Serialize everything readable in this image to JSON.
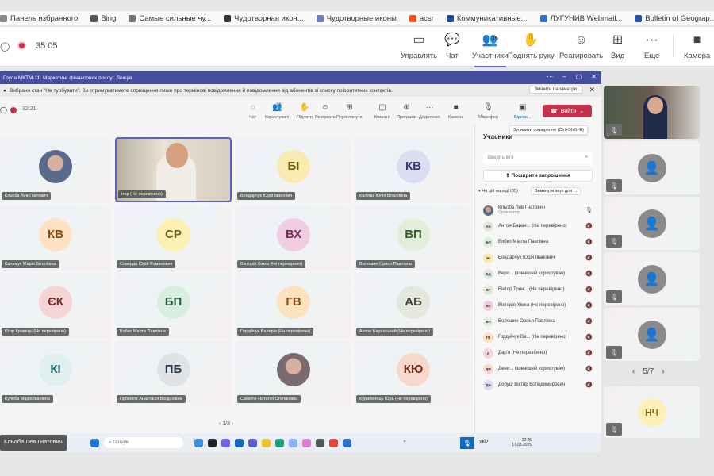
{
  "bookmarks": [
    {
      "label": "Панель избранного",
      "color": "#888"
    },
    {
      "label": "Bing",
      "color": "#555"
    },
    {
      "label": "Самые сильные чу...",
      "color": "#777"
    },
    {
      "label": "Чудотворная икон...",
      "color": "#333"
    },
    {
      "label": "Чудотворные иконы",
      "color": "#6a7fb8"
    },
    {
      "label": "acsr",
      "color": "#f25022"
    },
    {
      "label": "Коммуникативные...",
      "color": "#1e4ea8"
    },
    {
      "label": "ЛУГУНИВ Webmail...",
      "color": "#2a6fc9"
    },
    {
      "label": "Bulletin of Geograp...",
      "color": "#2b4fa0"
    }
  ],
  "outer": {
    "timer": "35:05",
    "participants_count": "35",
    "tools": [
      {
        "label": "Управлять",
        "icon": "▭"
      },
      {
        "label": "Чат",
        "icon": "💬"
      },
      {
        "label": "Участники",
        "icon": "👥"
      },
      {
        "label": "Поднять руку",
        "icon": "✋"
      },
      {
        "label": "Реагировать",
        "icon": "☺"
      },
      {
        "label": "Вид",
        "icon": "⊞"
      },
      {
        "label": "Еще",
        "icon": "···"
      },
      {
        "label": "Камера",
        "icon": "■"
      }
    ]
  },
  "window": {
    "title": "Група МКТМ-11. Маркетинг фінансових послуг. Лекція",
    "notification": "Вибрано стан \"Не турбувати\". Ви отримуватимете сповіщення лише про термінові повідомлення й повідомлення від абонентів зі списку пріоритетних контактів.",
    "change_settings": "Змінити параметри",
    "timer": "32:21",
    "participants_count": "35",
    "tools": [
      {
        "label": "Чат",
        "icon": "◌"
      },
      {
        "label": "Користувачі",
        "icon": "👥"
      },
      {
        "label": "Підняти",
        "icon": "✋"
      },
      {
        "label": "Реагувати",
        "icon": "☺"
      },
      {
        "label": "Переглянути",
        "icon": "⊞"
      },
      {
        "label": "Кімнати",
        "icon": "▢"
      },
      {
        "label": "Програми",
        "icon": "⊕"
      },
      {
        "label": "Додатково",
        "icon": "···"
      },
      {
        "label": "Камера",
        "icon": "■"
      },
      {
        "label": "Мікрофон",
        "icon": "🎙"
      },
      {
        "label": "Відкли...",
        "icon": "▣"
      }
    ],
    "leave": "Вийти",
    "tooltip": "Зупинити поширення (Ctrl+Shift+E)",
    "pager": "1/3"
  },
  "tiles": [
    {
      "initials": "",
      "name": "Кльоба Лев Гнатович",
      "bg": "#5a6a8a",
      "fg": "#fff",
      "photo": true
    },
    {
      "initials": "",
      "name": "Ігор (Не перевірено)",
      "bg": "#c8b8a0",
      "fg": "#fff",
      "video": true
    },
    {
      "initials": "БІ",
      "name": "Бондарчук Юрій Іванович",
      "bg": "#fbeab0",
      "fg": "#7a5a10"
    },
    {
      "initials": "КВ",
      "name": "Калічак Юлія Віталіївна",
      "bg": "#dcdcf2",
      "fg": "#3a3a7a"
    },
    {
      "initials": "КВ",
      "name": "Кальмук Марія Віталіївна",
      "bg": "#fde3c4",
      "fg": "#8a4a10"
    },
    {
      "initials": "СР",
      "name": "Соверда Юрій Романович",
      "bg": "#fcefb4",
      "fg": "#7a5a10"
    },
    {
      "initials": "ВХ",
      "name": "Вікторія Хімка (Не перевірено)",
      "bg": "#f0cde0",
      "fg": "#7a2a5a"
    },
    {
      "initials": "ВП",
      "name": "Волошин Орися Павлівна",
      "bg": "#e2eedb",
      "fg": "#3a5a2a"
    },
    {
      "initials": "ЄК",
      "name": "Єгор Кравець (Не перевірено)",
      "bg": "#f7d4d4",
      "fg": "#7a2a2a"
    },
    {
      "initials": "БП",
      "name": "Бобко Марта Павлівна",
      "bg": "#d9efdd",
      "fg": "#2a5a3a"
    },
    {
      "initials": "ГВ",
      "name": "Гордійчук Валерія (Не перевірено)",
      "bg": "#fde2c0",
      "fg": "#8a4a10"
    },
    {
      "initials": "АБ",
      "name": "Антон Баранський (Не перевірено)",
      "bg": "#e4e8dc",
      "fg": "#4a4a3a"
    },
    {
      "initials": "КІ",
      "name": "Кулеба Марія Іванівна",
      "bg": "#dff0ef",
      "fg": "#1a6a6a"
    },
    {
      "initials": "ПБ",
      "name": "Прокопів Анастасія Богданівна",
      "bg": "#dfe3e6",
      "fg": "#2a3a4a"
    },
    {
      "initials": "",
      "name": "Самотій Наталія Степанівна",
      "bg": "#7a6a70",
      "fg": "#fff",
      "photo": true
    },
    {
      "initials": "КЮ",
      "name": "Куриленець Юра (Не перевірено)",
      "bg": "#f9d8cc",
      "fg": "#7a2a1a"
    }
  ],
  "panel": {
    "title": "Учасники",
    "search_placeholder": "Введіть ім'я",
    "share": "Поширити запрошення",
    "group": "▾ На цій нараді (35)",
    "mute_all": "Вимкнути звук для ...",
    "items": [
      {
        "initials": "",
        "name": "Кльоба Лев Гнатович",
        "role": "Організатор",
        "bg": "#5a6a8a"
      },
      {
        "initials": "АБ",
        "name": "Антон Баран... (Не перевірено)",
        "bg": "#e4e8dc"
      },
      {
        "initials": "БП",
        "name": "Бобко Марта Павлівна",
        "bg": "#d9efdd"
      },
      {
        "initials": "БІ",
        "name": "Бондарчук Юрій Іванович",
        "bg": "#fbeab0"
      },
      {
        "initials": "ВД",
        "name": "Веро... (зовнішній користувач)",
        "bg": "#d9ebe0"
      },
      {
        "initials": "ВТ",
        "name": "Віктор Трин... (Не перевірено)",
        "bg": "#e4e8dc"
      },
      {
        "initials": "ВХ",
        "name": "Вікторія Хімка (Не перевірено)",
        "bg": "#f0cde0"
      },
      {
        "initials": "ВП",
        "name": "Волошин Орися Павлівна",
        "bg": "#e2eedb"
      },
      {
        "initials": "ГВ",
        "name": "Гордійчук Ва... (Не перевірено)",
        "bg": "#fde2c0"
      },
      {
        "initials": "Д",
        "name": "Дар'я (Не перевірено)",
        "bg": "#f7d4e0"
      },
      {
        "initials": "ДФ",
        "name": "Дени... (зовнішній користувач)",
        "bg": "#f9d8cc"
      },
      {
        "initials": "ДВ",
        "name": "Добуш Віктор Володимирович",
        "bg": "#dcdcf2"
      }
    ]
  },
  "side": {
    "pager": "5/7",
    "last_initials": "НЧ"
  },
  "taskbar": {
    "presenter": "Кльоба Лев Гнатович",
    "search": "Пошук",
    "lang": "УКР",
    "time": "12:25",
    "date": "17.03.2025"
  }
}
